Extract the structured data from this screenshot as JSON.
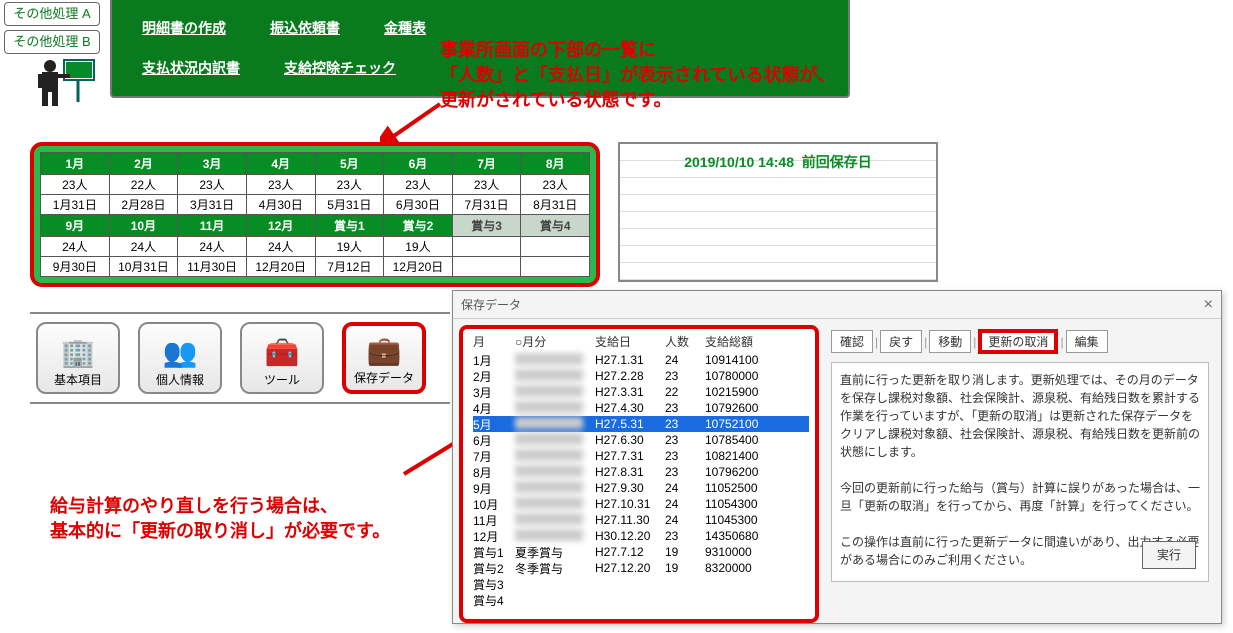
{
  "sideButtons": [
    "その他処理 A",
    "その他処理 B"
  ],
  "nav": {
    "row1": [
      "明細書の作成",
      "振込依頼書",
      "金種表"
    ],
    "row2": [
      "支払状況内訳書",
      "支給控除チェック"
    ]
  },
  "annotation1": "事業所画面の下部の一覧に\n「人数」と「支払日」が表示されている状態が、\n更新がされている状態です。",
  "annotation2": "給与計算のやり直しを行う場合は、\n基本的に「更新の取り消し」が必要です。",
  "status": {
    "datetime": "2019/10/10 14:48",
    "label": "前回保存日"
  },
  "summary": {
    "headers1": [
      "1月",
      "2月",
      "3月",
      "4月",
      "5月",
      "6月",
      "7月",
      "8月"
    ],
    "counts1": [
      "23人",
      "22人",
      "23人",
      "23人",
      "23人",
      "23人",
      "23人",
      "23人"
    ],
    "dates1": [
      "1月31日",
      "2月28日",
      "3月31日",
      "4月30日",
      "5月31日",
      "6月30日",
      "7月31日",
      "8月31日"
    ],
    "headers2": [
      "9月",
      "10月",
      "11月",
      "12月",
      "賞与1",
      "賞与2",
      "賞与3",
      "賞与4"
    ],
    "headers2grey": [
      false,
      false,
      false,
      false,
      false,
      false,
      true,
      true
    ],
    "counts2": [
      "24人",
      "24人",
      "24人",
      "24人",
      "19人",
      "19人",
      "",
      ""
    ],
    "dates2": [
      "9月30日",
      "10月31日",
      "11月30日",
      "12月20日",
      "7月12日",
      "12月20日",
      "",
      ""
    ]
  },
  "tools": [
    {
      "label": "基本項目",
      "icon": "🏢"
    },
    {
      "label": "個人情報",
      "icon": "👥"
    },
    {
      "label": "ツール",
      "icon": "🧰"
    },
    {
      "label": "保存データ",
      "icon": "💼",
      "selected": true
    }
  ],
  "dialog": {
    "title": "保存データ",
    "headers": [
      "月",
      "○月分",
      "支給日",
      "人数",
      "支給総額"
    ],
    "rows": [
      {
        "m": "1月",
        "d": "H27.1.31",
        "n": "24",
        "t": "10914100"
      },
      {
        "m": "2月",
        "d": "H27.2.28",
        "n": "23",
        "t": "10780000"
      },
      {
        "m": "3月",
        "d": "H27.3.31",
        "n": "22",
        "t": "10215900"
      },
      {
        "m": "4月",
        "d": "H27.4.30",
        "n": "23",
        "t": "10792600"
      },
      {
        "m": "5月",
        "d": "H27.5.31",
        "n": "23",
        "t": "10752100",
        "sel": true
      },
      {
        "m": "6月",
        "d": "H27.6.30",
        "n": "23",
        "t": "10785400"
      },
      {
        "m": "7月",
        "d": "H27.7.31",
        "n": "23",
        "t": "10821400"
      },
      {
        "m": "8月",
        "d": "H27.8.31",
        "n": "23",
        "t": "10796200"
      },
      {
        "m": "9月",
        "d": "H27.9.30",
        "n": "24",
        "t": "11052500"
      },
      {
        "m": "10月",
        "d": "H27.10.31",
        "n": "24",
        "t": "11054300"
      },
      {
        "m": "11月",
        "d": "H27.11.30",
        "n": "24",
        "t": "11045300"
      },
      {
        "m": "12月",
        "d": "H30.12.20",
        "n": "23",
        "t": "14350680"
      },
      {
        "m": "賞与1",
        "name": "夏季賞与",
        "d": "H27.7.12",
        "n": "19",
        "t": "9310000"
      },
      {
        "m": "賞与2",
        "name": "冬季賞与",
        "d": "H27.12.20",
        "n": "19",
        "t": "8320000"
      },
      {
        "m": "賞与3"
      },
      {
        "m": "賞与4"
      }
    ],
    "tabs": [
      "確認",
      "戻す",
      "移動",
      "更新の取消",
      "編集"
    ],
    "tabsHighlightIndex": 3,
    "desc": "直前に行った更新を取り消します。更新処理では、その月のデータを保存し課税対象額、社会保険計、源泉税、有給残日数を累計する作業を行っていますが、「更新の取消」は更新された保存データをクリアし課税対象額、社会保険計、源泉税、有給残日数を更新前の状態にします。\n\n今回の更新前に行った給与（賞与）計算に誤りがあった場合は、一旦「更新の取消」を行ってから、再度「計算」を行ってください。\n\nこの操作は直前に行った更新データに間違いがあり、出力する必要がある場合にのみご利用ください。",
    "execLabel": "実行"
  }
}
